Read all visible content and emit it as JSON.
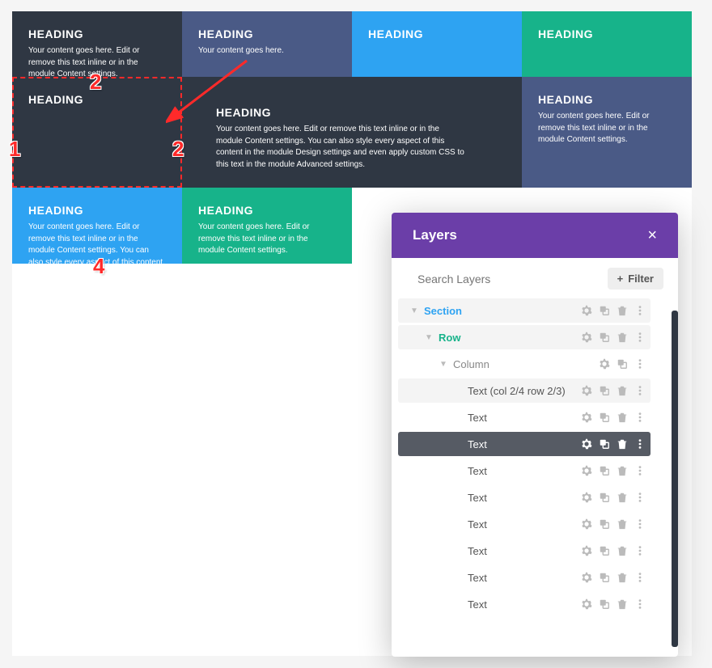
{
  "annotations": {
    "n1": "1",
    "n2a": "2",
    "n2b": "2",
    "n4": "4"
  },
  "grid": {
    "r1c1": {
      "heading": "HEADING",
      "body": "Your content goes here. Edit or remove this text inline or in the module Content settings."
    },
    "r1c2": {
      "heading": "HEADING",
      "body": "Your content goes here."
    },
    "r1c3": {
      "heading": "HEADING"
    },
    "r1c4": {
      "heading": "HEADING"
    },
    "r2c1": {
      "heading": "HEADING"
    },
    "r2c23": {
      "heading": "HEADING",
      "body": "Your content goes here. Edit or remove this text inline or in the module Content settings. You can also style every aspect of this content in the module Design settings and even apply custom CSS to this text in the module Advanced settings."
    },
    "r2c4": {
      "heading": "HEADING",
      "body": "Your content goes here. Edit or remove this text inline or in the module Content settings."
    },
    "r3c1": {
      "heading": "HEADING",
      "body": "Your content goes here. Edit or remove this text inline or in the module Content settings. You can also style every aspect of this content."
    },
    "r3c2": {
      "heading": "HEADING",
      "body": "Your content goes here. Edit or remove this text inline or in the module Content settings."
    }
  },
  "layers": {
    "title": "Layers",
    "search_placeholder": "Search Layers",
    "filter_label": "Filter",
    "items": [
      {
        "label": "Section",
        "kind": "section",
        "indent": 1,
        "caret": "down",
        "hov": true
      },
      {
        "label": "Row",
        "kind": "row",
        "indent": 2,
        "caret": "down",
        "hov": true
      },
      {
        "label": "Column",
        "kind": "col",
        "indent": 3,
        "caret": "down"
      },
      {
        "label": "Text (col 2/4 row 2/3)",
        "kind": "mod",
        "indent": 4,
        "bg": true
      },
      {
        "label": "Text",
        "kind": "mod",
        "indent": 4
      },
      {
        "label": "Text",
        "kind": "mod",
        "indent": 4,
        "sel": true
      },
      {
        "label": "Text",
        "kind": "mod",
        "indent": 4
      },
      {
        "label": "Text",
        "kind": "mod",
        "indent": 4
      },
      {
        "label": "Text",
        "kind": "mod",
        "indent": 4
      },
      {
        "label": "Text",
        "kind": "mod",
        "indent": 4
      },
      {
        "label": "Text",
        "kind": "mod",
        "indent": 4
      },
      {
        "label": "Text",
        "kind": "mod",
        "indent": 4
      }
    ]
  }
}
